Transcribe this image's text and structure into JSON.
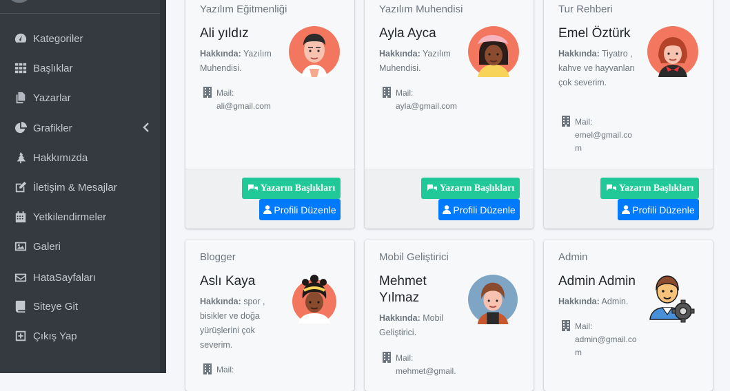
{
  "sidebar": {
    "items": [
      {
        "label": "Kategoriler",
        "icon": "tachometer-icon"
      },
      {
        "label": "Başlıklar",
        "icon": "grid-icon"
      },
      {
        "label": "Yazarlar",
        "icon": "copy-icon"
      },
      {
        "label": "Grafikler",
        "icon": "pie-chart-icon"
      },
      {
        "label": "Hakkımızda",
        "icon": "tree-icon"
      },
      {
        "label": "İletişim & Mesajlar",
        "icon": "edit-icon"
      },
      {
        "label": "Yetkilendirmeler",
        "icon": "calendar-icon"
      },
      {
        "label": "Galeri",
        "icon": "image-icon"
      },
      {
        "label": "HataSayfaları",
        "icon": "envelope-icon"
      },
      {
        "label": "Siteye Git",
        "icon": "book-icon"
      },
      {
        "label": "Çıkış Yap",
        "icon": "plus-square-icon"
      }
    ]
  },
  "labels": {
    "about": "Hakkında:",
    "mail": "Mail:",
    "btn_titles": "Yazarın Başlıkları",
    "btn_edit": "Profili Düzenle"
  },
  "cards": [
    {
      "job": "Yazılım Eğitmenliği",
      "name": "Ali yıldız",
      "about": "Yazılım Muhendisi.",
      "email": "ali@gmail.com"
    },
    {
      "job": "Yazılım Muhendisi",
      "name": "Ayla Ayca",
      "about": "Yazılım Muhendisi.",
      "email": "ayla@gmail.com"
    },
    {
      "job": "Tur Rehberi",
      "name": "Emel Öztürk",
      "about": "Tiyatro , kahve ve hayvanları çok severim.",
      "email": "emel@gmail.com"
    },
    {
      "job": "Blogger",
      "name": "Aslı Kaya",
      "about": "spor , bisikler ve doğa yürüşlerini çok severim.",
      "email": ""
    },
    {
      "job": "Mobil Geliştirici",
      "name": "Mehmet Yılmaz",
      "about": "Mobil Geliştirici.",
      "email": "mehmet@gmail."
    },
    {
      "job": "Admin",
      "name": "Admin Admin",
      "about": "Admin.",
      "email": "admin@gmail.com"
    }
  ],
  "colors": {
    "sidebar_bg": "#343a40",
    "green_button": "#20c997",
    "blue_button": "#007bff"
  }
}
